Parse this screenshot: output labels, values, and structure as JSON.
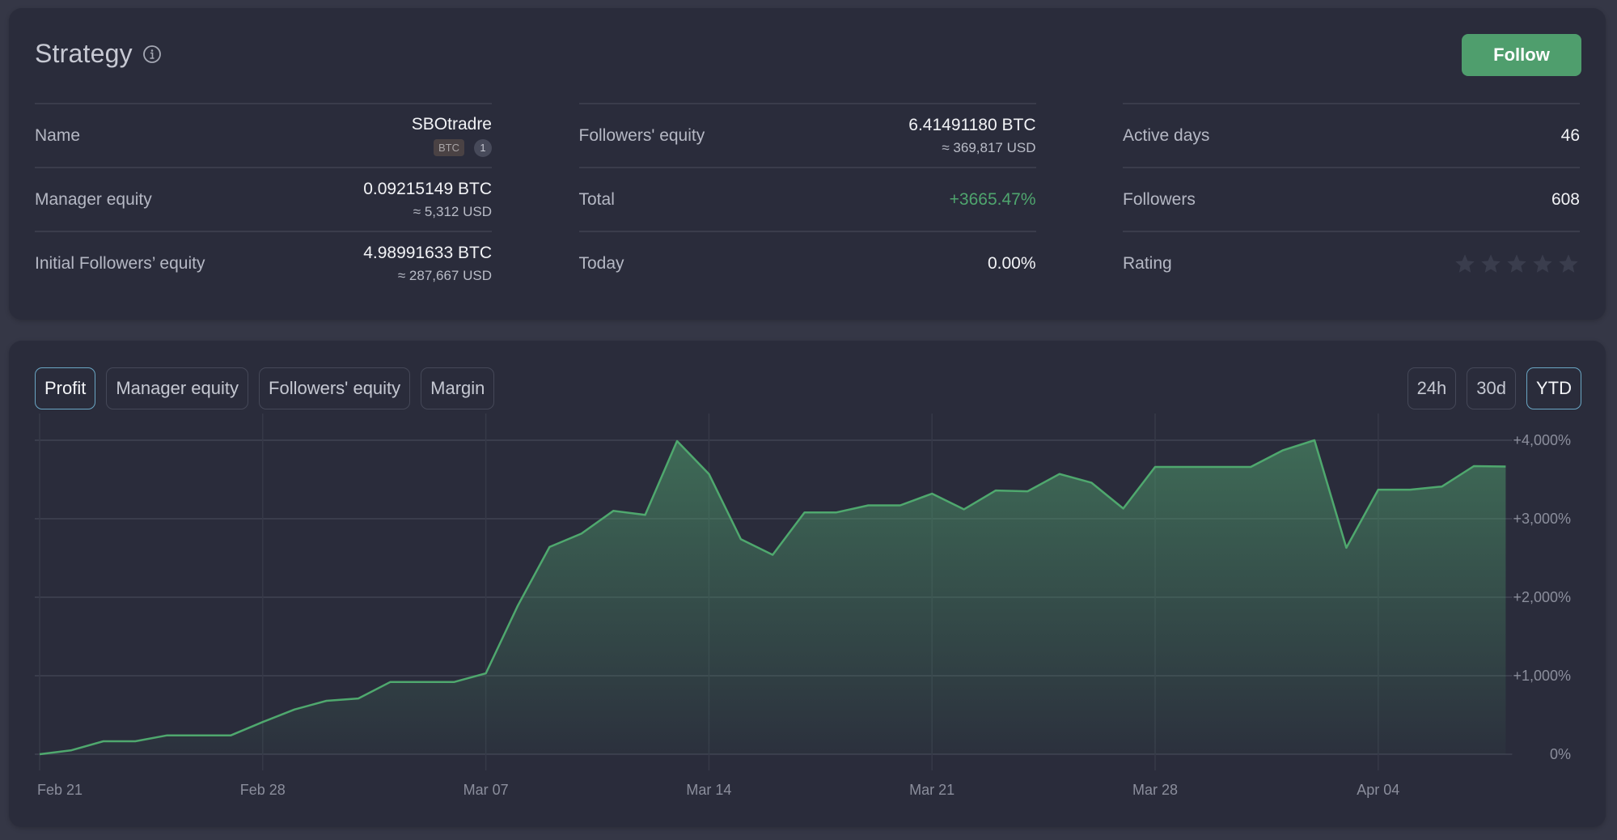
{
  "strategy": {
    "title": "Strategy",
    "follow_label": "Follow",
    "columns": [
      [
        {
          "label": "Name",
          "value": "SBOtradre",
          "badge": "BTC",
          "badge_count": "1"
        },
        {
          "label": "Manager equity",
          "value": "0.09215149 BTC",
          "sub": "≈ 5,312 USD"
        },
        {
          "label": "Initial Followers’ equity",
          "value": "4.98991633 BTC",
          "sub": "≈ 287,667 USD"
        }
      ],
      [
        {
          "label": "Followers' equity",
          "value": "6.41491180 BTC",
          "sub": "≈ 369,817 USD"
        },
        {
          "label": "Total",
          "value": "+3665.47%"
        },
        {
          "label": "Today",
          "value": "0.00%"
        }
      ],
      [
        {
          "label": "Active days",
          "value": "46"
        },
        {
          "label": "Followers",
          "value": "608"
        },
        {
          "label": "Rating",
          "rating": 0,
          "rating_max": 5
        }
      ]
    ]
  },
  "colors": {
    "accent_green": "#4f9e6d",
    "positive_text": "#4fa56e",
    "active_border": "#6aa6c4",
    "line": "#4fa86e",
    "star_empty": "#3a3d4d"
  },
  "chart": {
    "tabs": [
      {
        "label": "Profit",
        "active": true
      },
      {
        "label": "Manager equity",
        "active": false
      },
      {
        "label": "Followers' equity",
        "active": false
      },
      {
        "label": "Margin",
        "active": false
      }
    ],
    "ranges": [
      {
        "label": "24h",
        "active": false
      },
      {
        "label": "30d",
        "active": false
      },
      {
        "label": "YTD",
        "active": true
      }
    ]
  },
  "chart_data": {
    "type": "area",
    "title": "Profit",
    "xlabel": "",
    "ylabel": "",
    "x": [
      "Feb 21",
      "Feb 22",
      "Feb 23",
      "Feb 24",
      "Feb 25",
      "Feb 26",
      "Feb 27",
      "Feb 28",
      "Mar 01",
      "Mar 02",
      "Mar 03",
      "Mar 04",
      "Mar 05",
      "Mar 06",
      "Mar 07",
      "Mar 08",
      "Mar 09",
      "Mar 10",
      "Mar 11",
      "Mar 12",
      "Mar 13",
      "Mar 14",
      "Mar 15",
      "Mar 16",
      "Mar 17",
      "Mar 18",
      "Mar 19",
      "Mar 20",
      "Mar 21",
      "Mar 22",
      "Mar 23",
      "Mar 24",
      "Mar 25",
      "Mar 26",
      "Mar 27",
      "Mar 28",
      "Mar 29",
      "Mar 30",
      "Mar 31",
      "Apr 01",
      "Apr 02",
      "Apr 03",
      "Apr 04",
      "Apr 05",
      "Apr 06",
      "Apr 07",
      "Apr 08"
    ],
    "series": [
      {
        "name": "Profit (%)",
        "values": [
          0,
          50,
          165,
          165,
          240,
          240,
          240,
          410,
          570,
          680,
          710,
          920,
          920,
          920,
          1030,
          1890,
          2640,
          2810,
          3100,
          3050,
          3990,
          3570,
          2740,
          2540,
          3080,
          3080,
          3170,
          3170,
          3320,
          3120,
          3360,
          3350,
          3570,
          3460,
          3130,
          3660,
          3660,
          3660,
          3660,
          3870,
          4000,
          2630,
          3370,
          3370,
          3410,
          3670,
          3665
        ]
      }
    ],
    "x_ticks": [
      {
        "index": 0,
        "label": "Feb 21"
      },
      {
        "index": 7,
        "label": "Feb 28"
      },
      {
        "index": 14,
        "label": "Mar 07"
      },
      {
        "index": 21,
        "label": "Mar 14"
      },
      {
        "index": 28,
        "label": "Mar 21"
      },
      {
        "index": 35,
        "label": "Mar 28"
      },
      {
        "index": 42,
        "label": "Apr 04"
      }
    ],
    "y_ticks": [
      {
        "value": 0,
        "label": "0%"
      },
      {
        "value": 1000,
        "label": "+1,000%"
      },
      {
        "value": 2000,
        "label": "+2,000%"
      },
      {
        "value": 3000,
        "label": "+3,000%"
      },
      {
        "value": 4000,
        "label": "+4,000%"
      }
    ],
    "ylim": [
      0,
      4000
    ],
    "grid": true,
    "y_axis_side": "right"
  }
}
